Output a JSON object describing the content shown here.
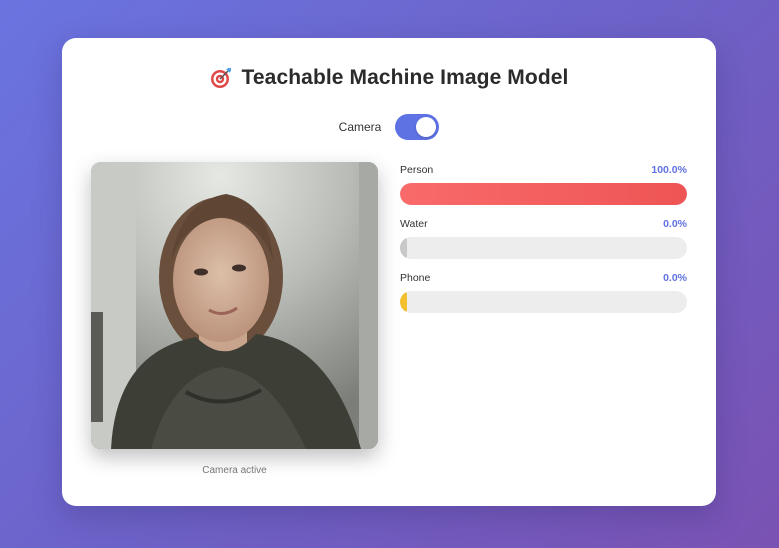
{
  "header": {
    "title": "Teachable Machine Image Model",
    "icon": "target-icon"
  },
  "camera": {
    "toggle_label": "Camera",
    "toggle_on": true,
    "status": "Camera active"
  },
  "predictions": [
    {
      "label": "Person",
      "value_text": "100.0%",
      "value": 1.0,
      "color": "#f0585a"
    },
    {
      "label": "Water",
      "value_text": "0.0%",
      "value": 0.0,
      "color": "#c8c8c8"
    },
    {
      "label": "Phone",
      "value_text": "0.0%",
      "value": 0.0,
      "color": "#f3c130"
    }
  ],
  "colors": {
    "accent": "#5f72e4",
    "background_start": "#6a74e0",
    "background_end": "#7a52b3"
  }
}
